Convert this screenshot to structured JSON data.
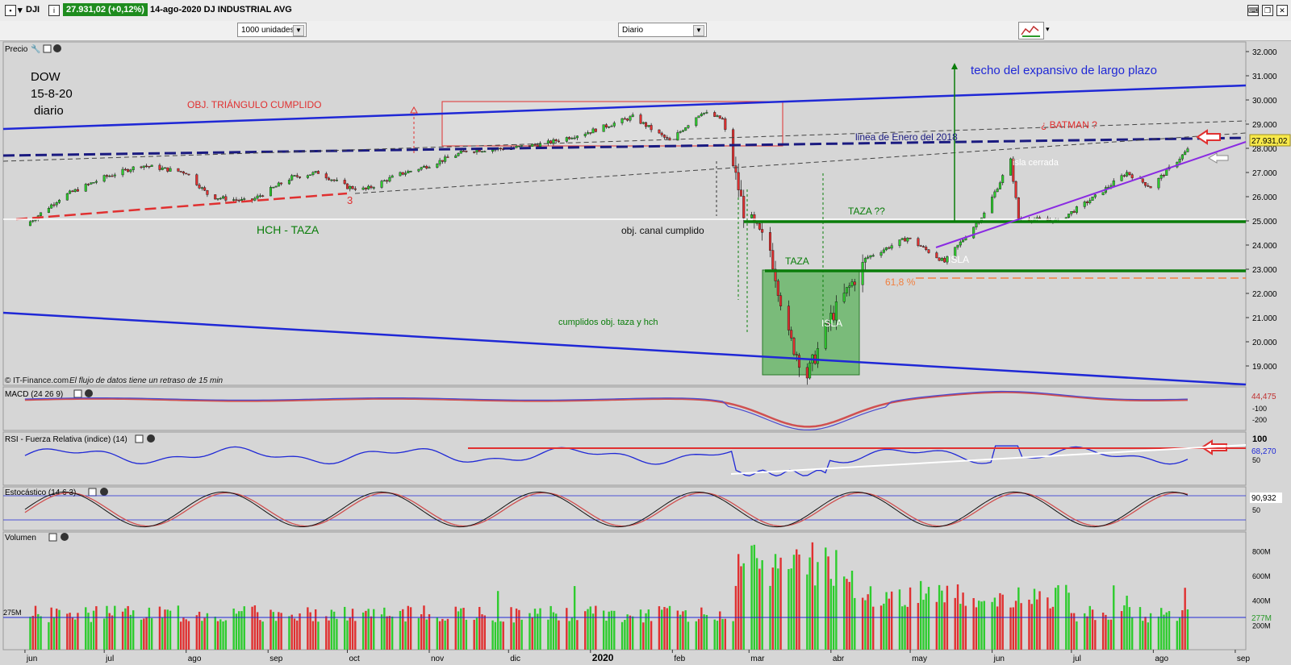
{
  "header": {
    "symbol": "DJI",
    "price_badge": "27.931,02 (+0,12%)",
    "date_title": "14-ago-2020 DJ INDUSTRIAL AVG",
    "units_select": "1000 unidades",
    "period_select": "Diario"
  },
  "panels": {
    "price": "Precio",
    "macd": "MACD (24 26 9)",
    "rsi": "RSI - Fuerza Relativa (indice) (14)",
    "stoch": "Estocástico (14 6 3)",
    "volume": "Volumen"
  },
  "annotations": {
    "dow": "DOW",
    "date": "15-8-20",
    "diario": "diario",
    "obj_triangulo": "OBJ. TRIÁNGULO CUMPLIDO",
    "techo": "techo del expansivo de largo plazo",
    "batman": "¿ BATMAN ?",
    "linea_enero": "linea de Enero del 2018",
    "isla_cerrada": "isla cerrada",
    "hch_taza": "HCH - TAZA",
    "obj_canal": "obj. canal cumplido",
    "taza_q": "TAZA ??",
    "isla1": "ISLA",
    "taza": "TAZA",
    "fib": "61,8 %",
    "isla2": "ISLA",
    "cumplidos": "cumplidos obj. taza y hch",
    "three": "3",
    "copyright": "© IT-Finance.com",
    "delay": "El flujo de datos tiene un retraso de 15 min"
  },
  "chart_data": {
    "type": "candlestick",
    "title": "DJ INDUSTRIAL AVG",
    "x_ticks": [
      "jun",
      "jul",
      "ago",
      "sep",
      "oct",
      "nov",
      "dic",
      "2020",
      "feb",
      "mar",
      "abr",
      "may",
      "jun",
      "jul",
      "ago",
      "sep"
    ],
    "price_ticks": [
      "32.000",
      "31.000",
      "30.000",
      "29.000",
      "28.000",
      "27.000",
      "26.000",
      "25.000",
      "24.000",
      "23.000",
      "22.000",
      "21.000",
      "20.000",
      "19.000"
    ],
    "ylim": [
      18200,
      32200
    ],
    "last_price": "27.931,02",
    "price_path": [
      [
        "2019-06-01",
        24800
      ],
      [
        "2019-06-15",
        26000
      ],
      [
        "2019-07-01",
        26800
      ],
      [
        "2019-07-15",
        27300
      ],
      [
        "2019-08-01",
        27000
      ],
      [
        "2019-08-10",
        26000
      ],
      [
        "2019-08-25",
        25800
      ],
      [
        "2019-09-10",
        26800
      ],
      [
        "2019-09-20",
        27000
      ],
      [
        "2019-10-01",
        26400
      ],
      [
        "2019-10-08",
        26300
      ],
      [
        "2019-10-20",
        26900
      ],
      [
        "2019-11-01",
        27300
      ],
      [
        "2019-11-15",
        27900
      ],
      [
        "2019-12-01",
        28000
      ],
      [
        "2019-12-15",
        28200
      ],
      [
        "2020-01-01",
        28700
      ],
      [
        "2020-01-17",
        29300
      ],
      [
        "2020-01-31",
        28300
      ],
      [
        "2020-02-12",
        29500
      ],
      [
        "2020-02-20",
        29200
      ],
      [
        "2020-02-28",
        25400
      ],
      [
        "2020-03-09",
        23800
      ],
      [
        "2020-03-16",
        20200
      ],
      [
        "2020-03-23",
        18600
      ],
      [
        "2020-04-01",
        21000
      ],
      [
        "2020-04-15",
        23500
      ],
      [
        "2020-04-30",
        24300
      ],
      [
        "2020-05-14",
        23300
      ],
      [
        "2020-05-29",
        25300
      ],
      [
        "2020-06-08",
        27500
      ],
      [
        "2020-06-11",
        25100
      ],
      [
        "2020-06-26",
        25000
      ],
      [
        "2020-07-10",
        26000
      ],
      [
        "2020-07-22",
        27000
      ],
      [
        "2020-07-31",
        26400
      ],
      [
        "2020-08-14",
        27931
      ]
    ],
    "macd_labels": [
      "-100",
      "-200"
    ],
    "macd_value": "44,475",
    "rsi_labels": [
      "100",
      "50"
    ],
    "rsi_value": "68,270",
    "stoch_labels": [
      "50"
    ],
    "stoch_value": "90,932",
    "volume_labels": [
      "800M",
      "600M",
      "400M",
      "200M"
    ],
    "volume_avg_label": "275M",
    "volume_avg_right": "277M"
  },
  "colors": {
    "up": "#2ecc2e",
    "down": "#e03030",
    "blue_line": "#1f28d6",
    "green_line": "#0a7d0a",
    "purple_line": "#8a2be2",
    "taza_box": "#5bb25b"
  }
}
